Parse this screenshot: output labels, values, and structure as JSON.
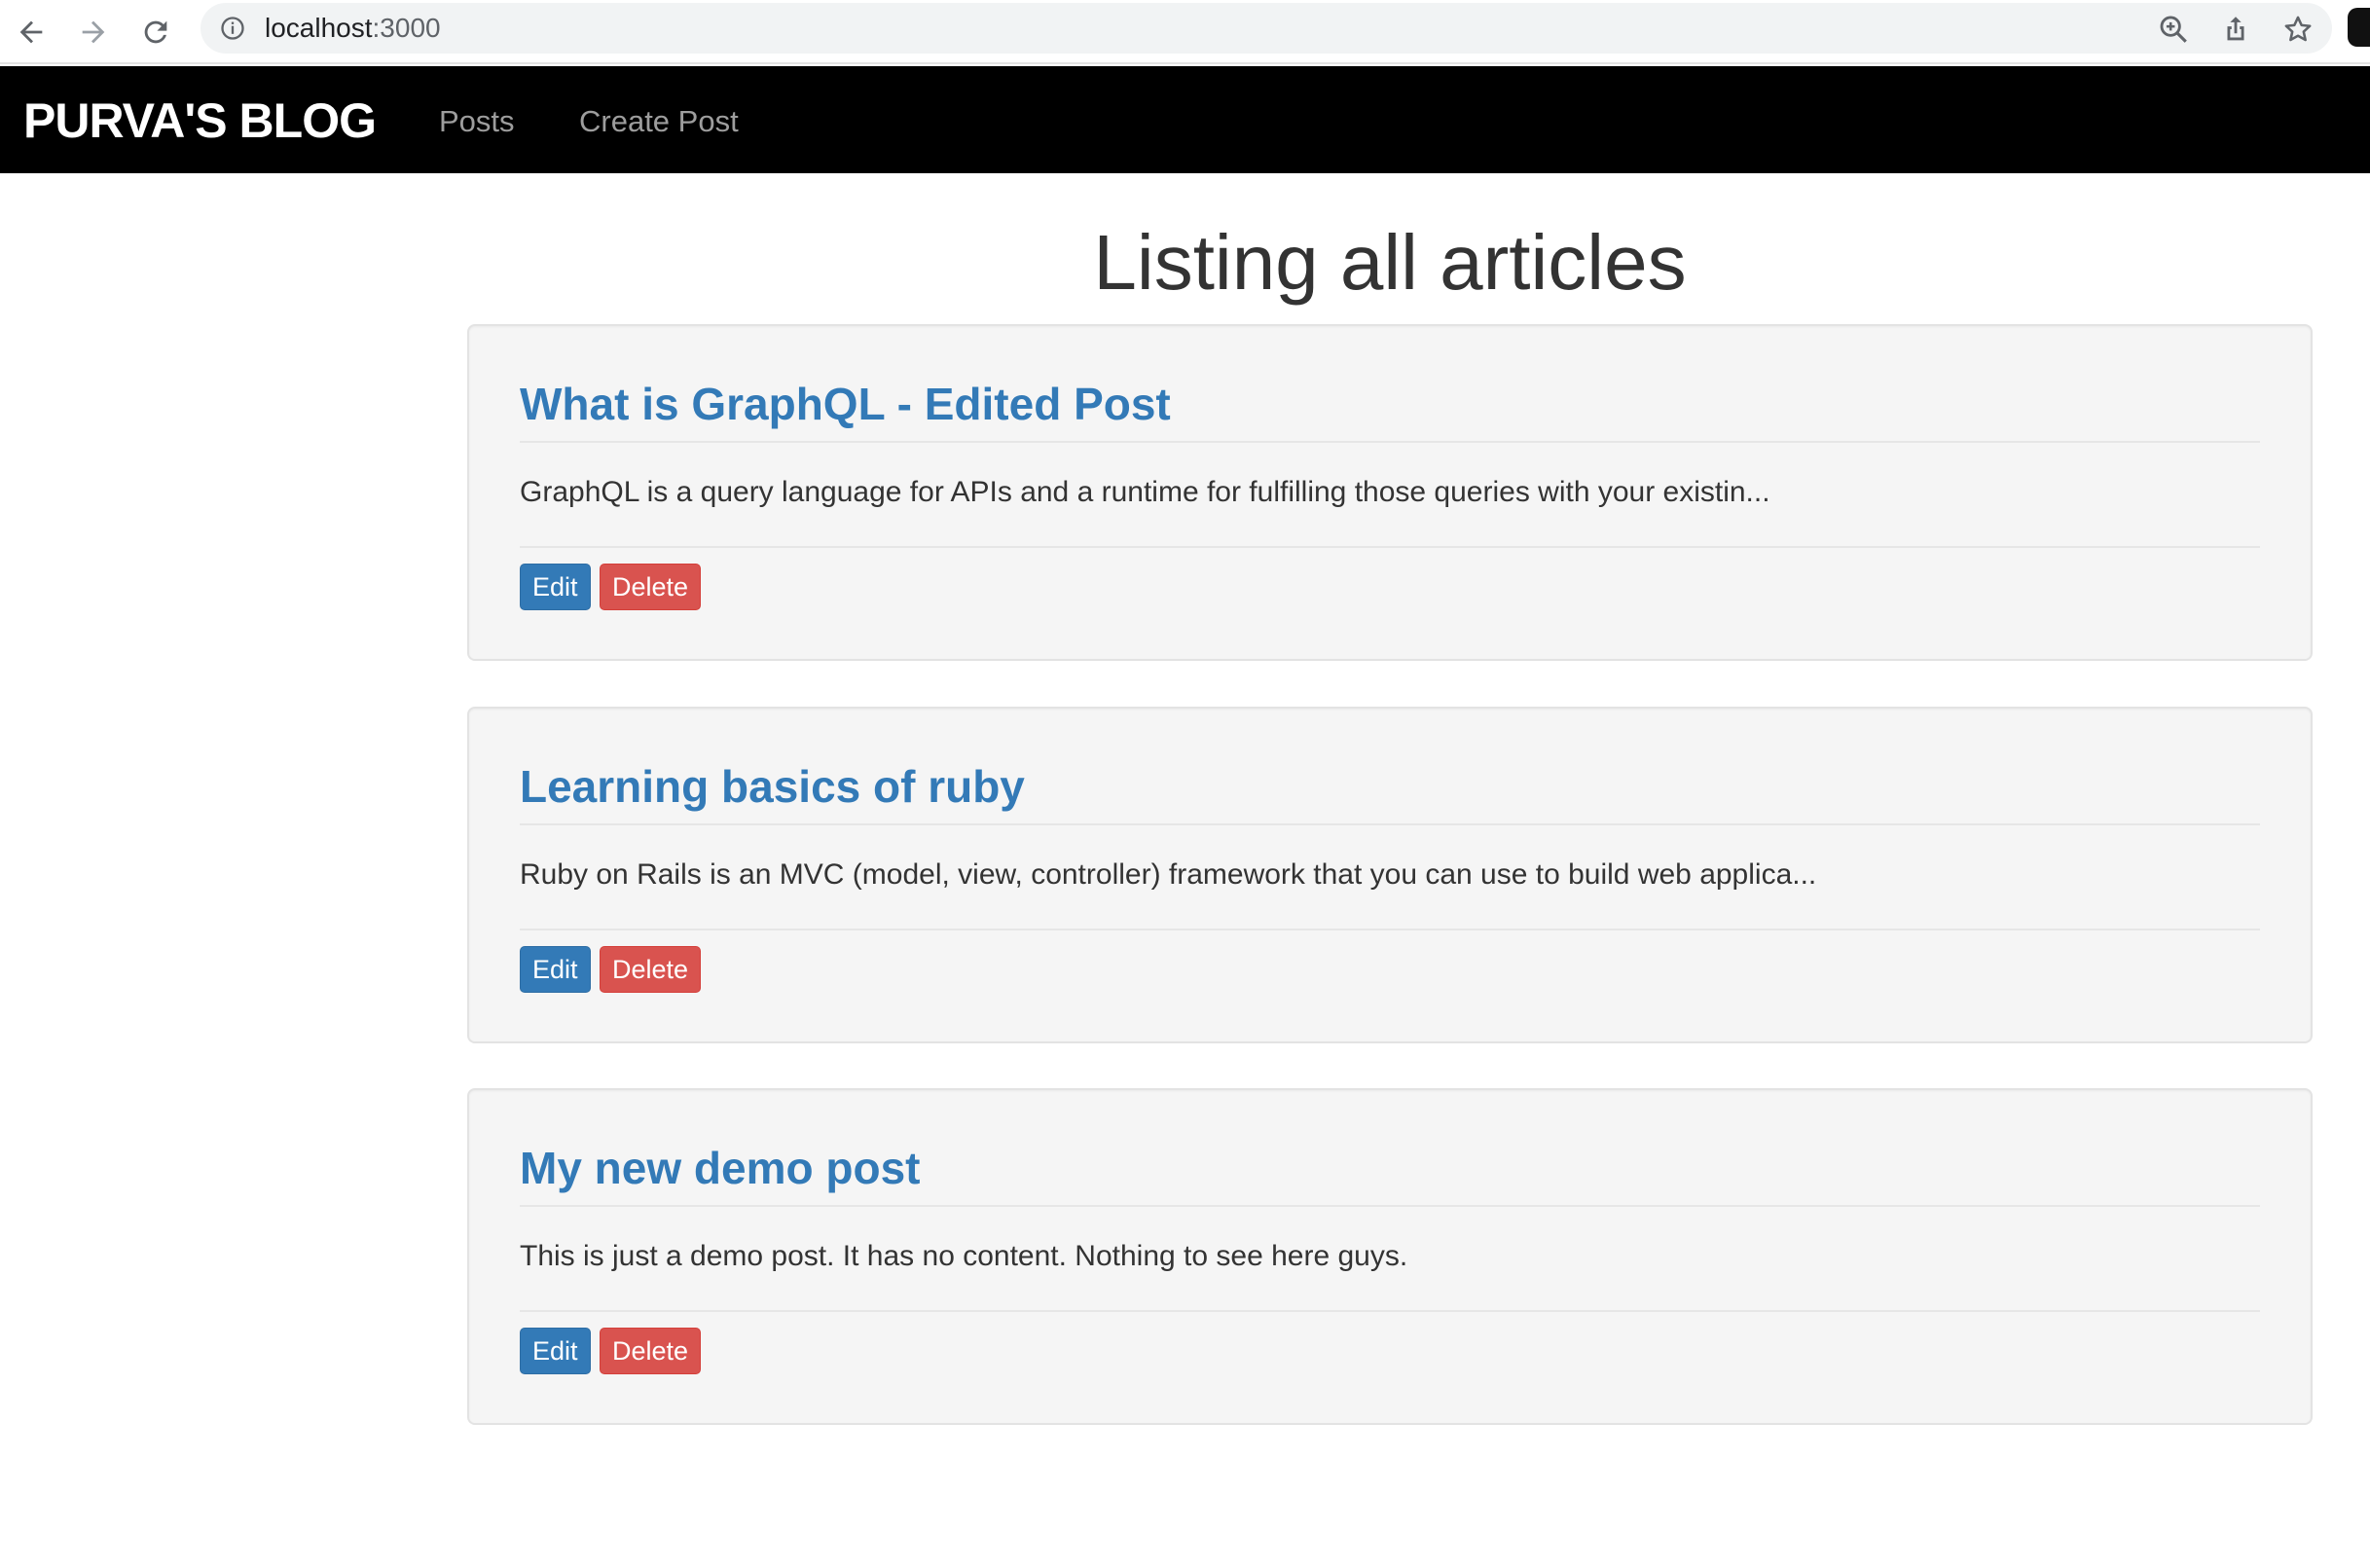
{
  "browser": {
    "url_host": "localhost",
    "url_port": ":3000"
  },
  "navbar": {
    "brand": "PURVA'S BLOG",
    "links": [
      "Posts",
      "Create Post"
    ]
  },
  "page": {
    "title": "Listing all articles"
  },
  "articles": [
    {
      "title": "What is GraphQL - Edited Post",
      "excerpt": "GraphQL is a query language for APIs and a runtime for fulfilling those queries with your existin...",
      "edit_label": "Edit",
      "delete_label": "Delete"
    },
    {
      "title": "Learning basics of ruby",
      "excerpt": "Ruby on Rails is an MVC (model, view, controller) framework that you can use to build web applica...",
      "edit_label": "Edit",
      "delete_label": "Delete"
    },
    {
      "title": "My new demo post",
      "excerpt": "This is just a demo post. It has no content. Nothing to see here guys.",
      "edit_label": "Edit",
      "delete_label": "Delete"
    }
  ],
  "colors": {
    "navbar_bg": "#000000",
    "link_blue": "#337ab7",
    "danger_red": "#d9534f",
    "well_bg": "#f5f5f5"
  }
}
